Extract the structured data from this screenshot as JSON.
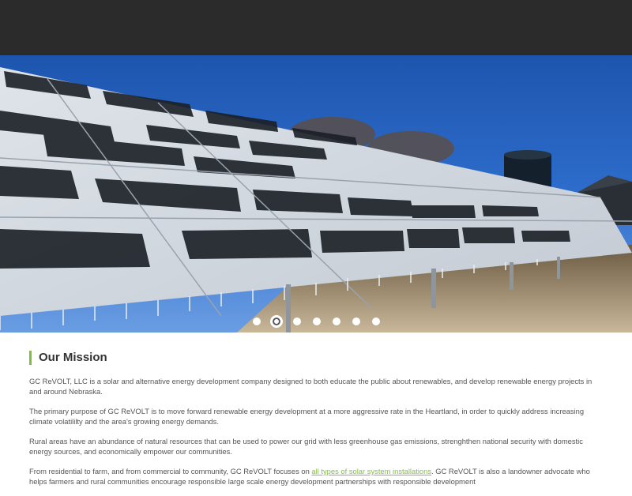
{
  "hero": {
    "slide_count": 7,
    "active_slide": 2
  },
  "mission": {
    "heading": "Our Mission",
    "p1": "GC ReVOLT, LLC is a solar and alternative energy development company designed to both educate the public about renewables, and develop renewable energy projects in and around Nebraska.",
    "p2": "The primary purpose of GC ReVOLT is to move forward renewable energy development at a more aggressive rate in the Heartland, in order to quickly address increasing climate volatililty and the area's growing energy demands.",
    "p3": "Rural areas have an abundance of natural resources that can be used to power our grid with less greenhouse gas emissions, strenghthen national security with domestic energy sources, and economically empower our communities.",
    "p4_before": "From residential to farm, and from commercial to community, GC ReVOLT focuses on ",
    "p4_link": "all types of solar system installations",
    "p4_after": ".   GC ReVOLT is also a landowner advocate who helps farmers and rural communities encourage responsible large scale energy development partnerships with responsible development"
  },
  "colors": {
    "topbar": "#2b2b2b",
    "accent": "#7fbf3f",
    "text": "#555555"
  }
}
